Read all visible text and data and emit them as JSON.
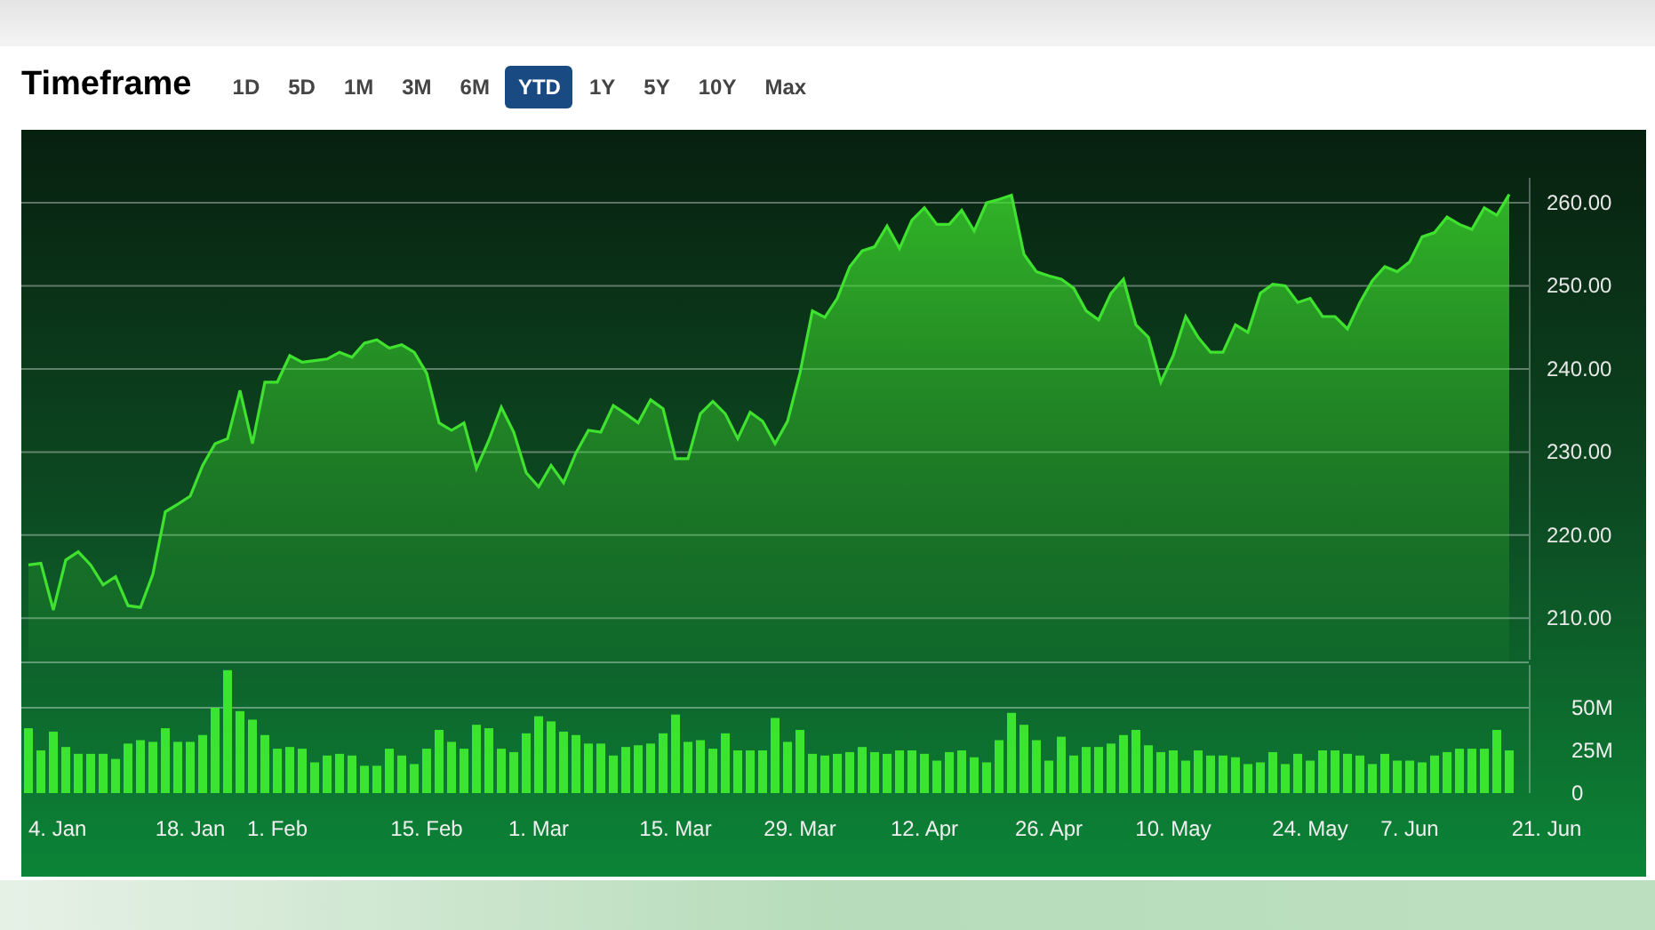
{
  "header": {
    "title": "Timeframe"
  },
  "timeframes": [
    {
      "label": "1D",
      "selected": false
    },
    {
      "label": "5D",
      "selected": false
    },
    {
      "label": "1M",
      "selected": false
    },
    {
      "label": "3M",
      "selected": false
    },
    {
      "label": "6M",
      "selected": false
    },
    {
      "label": "YTD",
      "selected": true
    },
    {
      "label": "1Y",
      "selected": false
    },
    {
      "label": "5Y",
      "selected": false
    },
    {
      "label": "10Y",
      "selected": false
    },
    {
      "label": "Max",
      "selected": false
    }
  ],
  "price_chart": {
    "chart_data": {
      "type": "area",
      "grid": true,
      "ylim": [
        205,
        263
      ],
      "yticks": [
        {
          "value": 210,
          "label": "210.00"
        },
        {
          "value": 220,
          "label": "220.00"
        },
        {
          "value": 230,
          "label": "230.00"
        },
        {
          "value": 240,
          "label": "240.00"
        },
        {
          "value": 250,
          "label": "250.00"
        },
        {
          "value": 260,
          "label": "260.00"
        }
      ],
      "series": [
        {
          "color": "#3ee22f",
          "values": [
            216.4,
            216.6,
            211,
            217,
            218,
            216.4,
            214,
            215,
            211.5,
            211.3,
            215.3,
            222.8,
            223.7,
            224.7,
            228.4,
            231,
            231.6,
            237.4,
            231,
            238.4,
            238.4,
            241.6,
            240.8,
            241,
            241.2,
            242,
            241.4,
            243.1,
            243.5,
            242.5,
            242.9,
            242,
            239.5,
            233.5,
            232.6,
            233.5,
            228,
            231.4,
            235.4,
            232.4,
            227.5,
            225.8,
            228.4,
            226.3,
            229.9,
            232.6,
            232.4,
            235.6,
            234.6,
            233.5,
            236.3,
            235.2,
            229.2,
            229.2,
            234.6,
            236.1,
            234.6,
            231.6,
            234.8,
            233.7,
            231,
            233.7,
            239.5,
            247,
            246.2,
            248.5,
            252.3,
            254.2,
            254.7,
            257.2,
            254.5,
            257.9,
            259.4,
            257.4,
            257.4,
            259.1,
            256.6,
            260,
            260.4,
            260.9,
            253.8,
            251.7,
            251.2,
            250.8,
            249.7,
            247,
            245.9,
            249.1,
            250.8,
            245.3,
            243.8,
            238.4,
            241.6,
            246.3,
            243.8,
            242,
            242,
            245.3,
            244.4,
            249.1,
            250.2,
            250,
            248,
            248.5,
            246.3,
            246.3,
            244.8,
            248,
            250.6,
            252.3,
            251.7,
            252.9,
            255.9,
            256.4,
            258.3,
            257.4,
            256.8,
            259.4,
            258.5,
            261
          ]
        }
      ]
    }
  },
  "volume_chart": {
    "date_labels": [
      "4. Jan",
      "18. Jan",
      "1. Feb",
      "15. Feb",
      "1. Mar",
      "15. Mar",
      "29. Mar",
      "12. Apr",
      "26. Apr",
      "10. May",
      "24. May",
      "7. Jun",
      "21. Jun"
    ],
    "chart_data": {
      "type": "bar",
      "ylim": [
        0,
        75
      ],
      "yticks": [
        {
          "value": 0,
          "label": "0"
        },
        {
          "value": 25,
          "label": "25M"
        },
        {
          "value": 50,
          "label": "50M"
        }
      ],
      "series": [
        {
          "color": "#3be42f",
          "values": [
            38,
            25,
            36,
            27,
            23,
            23,
            23,
            20,
            29,
            31,
            30,
            38,
            30,
            30,
            34,
            50,
            72,
            48,
            43,
            34,
            26,
            27,
            26,
            18,
            22,
            23,
            22,
            16,
            16,
            26,
            22,
            17,
            26,
            37,
            30,
            26,
            40,
            38,
            26,
            24,
            35,
            45,
            42,
            36,
            34,
            29,
            29,
            22,
            27,
            28,
            29,
            35,
            46,
            30,
            31,
            26,
            35,
            25,
            25,
            25,
            44,
            30,
            37,
            23,
            22,
            23,
            24,
            27,
            24,
            23,
            25,
            25,
            23,
            19,
            24,
            25,
            21,
            18,
            31,
            47,
            40,
            31,
            19,
            33,
            22,
            27,
            27,
            29,
            34,
            37,
            28,
            24,
            25,
            19,
            25,
            22,
            22,
            21,
            17,
            18,
            24,
            17,
            23,
            19,
            25,
            25,
            23,
            22,
            17,
            23,
            19,
            19,
            18,
            22,
            24,
            26,
            26,
            26,
            37,
            25
          ]
        }
      ]
    }
  }
}
